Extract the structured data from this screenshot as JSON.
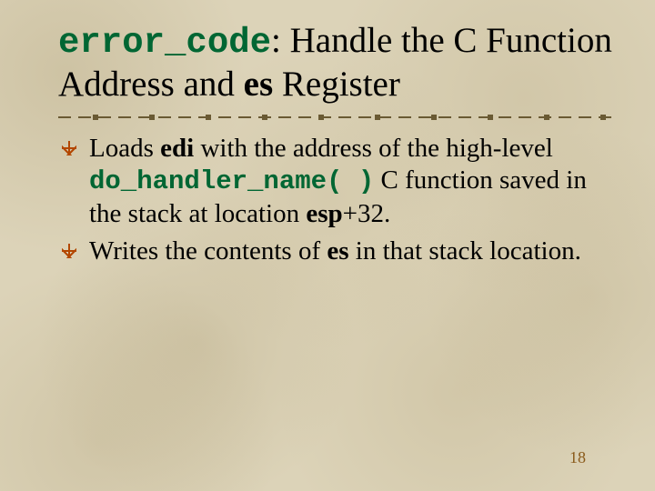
{
  "title": {
    "code": "error_code",
    "after_code": ": Handle the C Function Address and ",
    "bold_reg": "es",
    "tail": " Register"
  },
  "bullets": [
    {
      "p1": "Loads ",
      "b1": "edi",
      "p2": " with the address of the high-level ",
      "code": "do_handler_name( )",
      "p3": " C function saved in the stack at location ",
      "b2": "esp",
      "p4": "+32."
    },
    {
      "p1": "Writes the contents of ",
      "b1": "es",
      "p2": " in that stack location.",
      "code": "",
      "p3": "",
      "b2": "",
      "p4": ""
    }
  ],
  "page_number": "18"
}
